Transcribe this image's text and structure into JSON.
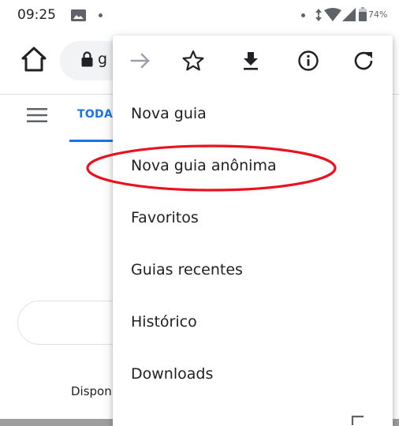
{
  "status_bar": {
    "time": "09:25",
    "battery_percent": "74%",
    "icons": [
      "gallery-icon",
      "notification-dot-icon",
      "data-arrows-icon",
      "wifi-icon",
      "cell-signal-icon",
      "battery-icon"
    ]
  },
  "toolbar": {
    "omnibox_text": "g",
    "icons": [
      "home-icon",
      "lock-icon"
    ]
  },
  "page": {
    "tab_label": "TODAS",
    "bottom_text": "Dispon"
  },
  "menu": {
    "icon_row": [
      "forward-arrow-icon",
      "star-icon",
      "download-icon",
      "info-icon",
      "refresh-icon"
    ],
    "items": [
      {
        "label": "Nova guia"
      },
      {
        "label": "Nova guia anônima"
      },
      {
        "label": "Favoritos"
      },
      {
        "label": "Guias recentes"
      },
      {
        "label": "Histórico"
      },
      {
        "label": "Downloads"
      }
    ]
  },
  "colors": {
    "accent_blue": "#1a73e8",
    "highlight_red": "#e8131f",
    "text_dark": "#202124",
    "icon_gray": "#5f6368",
    "disabled_gray": "#9aa0a6"
  }
}
